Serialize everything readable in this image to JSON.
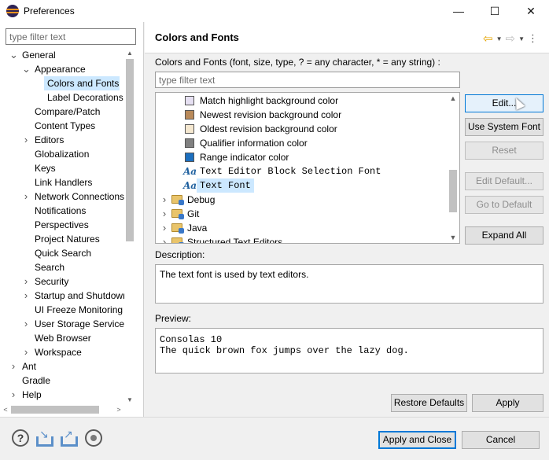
{
  "window": {
    "title": "Preferences",
    "minimize": "—",
    "maximize": "☐",
    "close": "✕"
  },
  "left": {
    "filter_placeholder": "type filter text",
    "tree": [
      {
        "label": "General",
        "level": 0,
        "twisty": "v"
      },
      {
        "label": "Appearance",
        "level": 1,
        "twisty": "v"
      },
      {
        "label": "Colors and Fonts",
        "level": 2,
        "twisty": "",
        "selected": true
      },
      {
        "label": "Label Decorations",
        "level": 2,
        "twisty": ""
      },
      {
        "label": "Compare/Patch",
        "level": 1,
        "twisty": ""
      },
      {
        "label": "Content Types",
        "level": 1,
        "twisty": ""
      },
      {
        "label": "Editors",
        "level": 1,
        "twisty": ">"
      },
      {
        "label": "Globalization",
        "level": 1,
        "twisty": ""
      },
      {
        "label": "Keys",
        "level": 1,
        "twisty": ""
      },
      {
        "label": "Link Handlers",
        "level": 1,
        "twisty": ""
      },
      {
        "label": "Network Connections",
        "level": 1,
        "twisty": ">"
      },
      {
        "label": "Notifications",
        "level": 1,
        "twisty": ""
      },
      {
        "label": "Perspectives",
        "level": 1,
        "twisty": ""
      },
      {
        "label": "Project Natures",
        "level": 1,
        "twisty": ""
      },
      {
        "label": "Quick Search",
        "level": 1,
        "twisty": ""
      },
      {
        "label": "Search",
        "level": 1,
        "twisty": ""
      },
      {
        "label": "Security",
        "level": 1,
        "twisty": ">"
      },
      {
        "label": "Startup and Shutdown",
        "level": 1,
        "twisty": ">"
      },
      {
        "label": "UI Freeze Monitoring",
        "level": 1,
        "twisty": ""
      },
      {
        "label": "User Storage Service",
        "level": 1,
        "twisty": ">"
      },
      {
        "label": "Web Browser",
        "level": 1,
        "twisty": ""
      },
      {
        "label": "Workspace",
        "level": 1,
        "twisty": ">"
      },
      {
        "label": "Ant",
        "level": 0,
        "twisty": ">"
      },
      {
        "label": "Gradle",
        "level": 0,
        "twisty": ""
      },
      {
        "label": "Help",
        "level": 0,
        "twisty": ">"
      }
    ]
  },
  "page": {
    "title": "Colors and Fonts",
    "description": "Colors and Fonts (font, size, type, ? = any character, * = any string) :",
    "filter_placeholder": "type filter text",
    "items": [
      {
        "label": "Match highlight background color",
        "kind": "color",
        "color": "#e6e0f2"
      },
      {
        "label": "Newest revision background color",
        "kind": "color",
        "color": "#b98a5a"
      },
      {
        "label": "Oldest revision background color",
        "kind": "color",
        "color": "#f5e8d0"
      },
      {
        "label": "Qualifier information color",
        "kind": "color",
        "color": "#808080"
      },
      {
        "label": "Range indicator color",
        "kind": "color",
        "color": "#1c6fbf"
      },
      {
        "label": "Text Editor Block Selection Font",
        "kind": "font"
      },
      {
        "label": "Text Font",
        "kind": "font",
        "selected": true
      },
      {
        "label": "Debug",
        "kind": "folder"
      },
      {
        "label": "Git",
        "kind": "folder"
      },
      {
        "label": "Java",
        "kind": "folder"
      },
      {
        "label": "Structured Text Editors",
        "kind": "folder"
      }
    ],
    "font_icon": "Aa",
    "buttons": {
      "edit": "Edit...",
      "use_system_font": "Use System Font",
      "reset": "Reset",
      "edit_default": "Edit Default...",
      "go_to_default": "Go to Default",
      "expand_all": "Expand All"
    },
    "description_label": "Description:",
    "description_text": "The text font is used by text editors.",
    "preview_label": "Preview:",
    "preview_lines": [
      "Consolas 10",
      "The quick brown fox jumps over the lazy dog."
    ],
    "restore_defaults": "Restore Defaults",
    "apply": "Apply"
  },
  "footer": {
    "apply_and_close": "Apply and Close",
    "cancel": "Cancel",
    "icons": [
      "help-icon",
      "import-icon",
      "export-icon",
      "record-icon"
    ]
  }
}
